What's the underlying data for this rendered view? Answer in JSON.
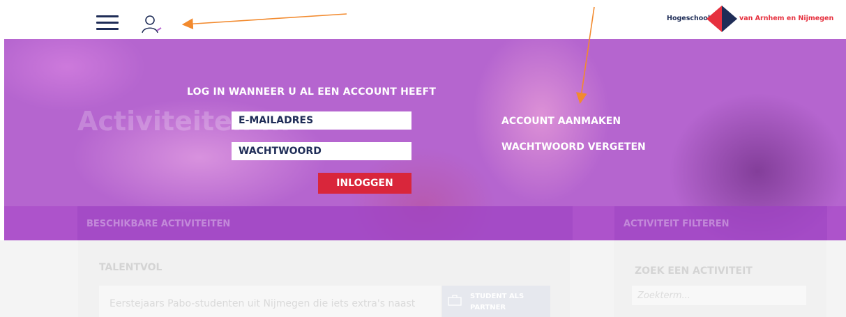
{
  "header": {
    "logo_left": "Hogeschool",
    "logo_right": "van Arnhem en Nijmegen",
    "colors": {
      "navy": "#1f2d57",
      "red": "#e6313f"
    }
  },
  "hero": {
    "bg_title": "Activiteiten ...",
    "login_heading": "LOG IN WANNEER U AL EEN ACCOUNT HEEFT",
    "email_placeholder": "E-MAILADRES",
    "password_placeholder": "WACHTWOORD",
    "login_button": "INLOGGEN",
    "create_account": "ACCOUNT AANMAKEN",
    "forgot_password": "WACHTWOORD VERGETEN",
    "bottom_left_label": "BESCHIKBARE ACTIVITEITEN",
    "bottom_right_label": "ACTIVITEIT FILTEREN",
    "colors": {
      "overlay": "#b565cf",
      "button": "#d9263b"
    }
  },
  "content": {
    "section_title": "TALENTVOL",
    "activity_text": "Eerstejaars Pabo-studenten uit Nijmegen die iets extra's naast",
    "tag_label": "STUDENT ALS PARTNER",
    "side_title": "ZOEK EEN ACTIVITEIT",
    "search_placeholder": "Zoekterm..."
  },
  "annotations": {
    "arrow_color": "#f28a2e"
  }
}
